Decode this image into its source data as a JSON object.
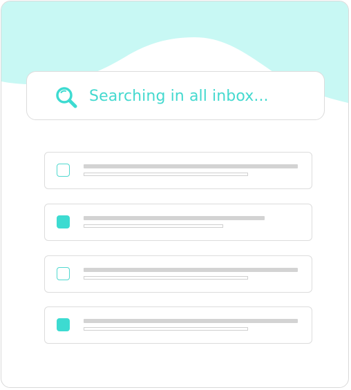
{
  "colors": {
    "accent": "#3ddbd1",
    "wave": "#c8f8f4",
    "skeleton": "#d3d3d3"
  },
  "search": {
    "icon": "search-icon",
    "placeholder": "Searching in all inbox..."
  },
  "rows": [
    {
      "checked": false
    },
    {
      "checked": true
    },
    {
      "checked": false
    },
    {
      "checked": true
    }
  ]
}
